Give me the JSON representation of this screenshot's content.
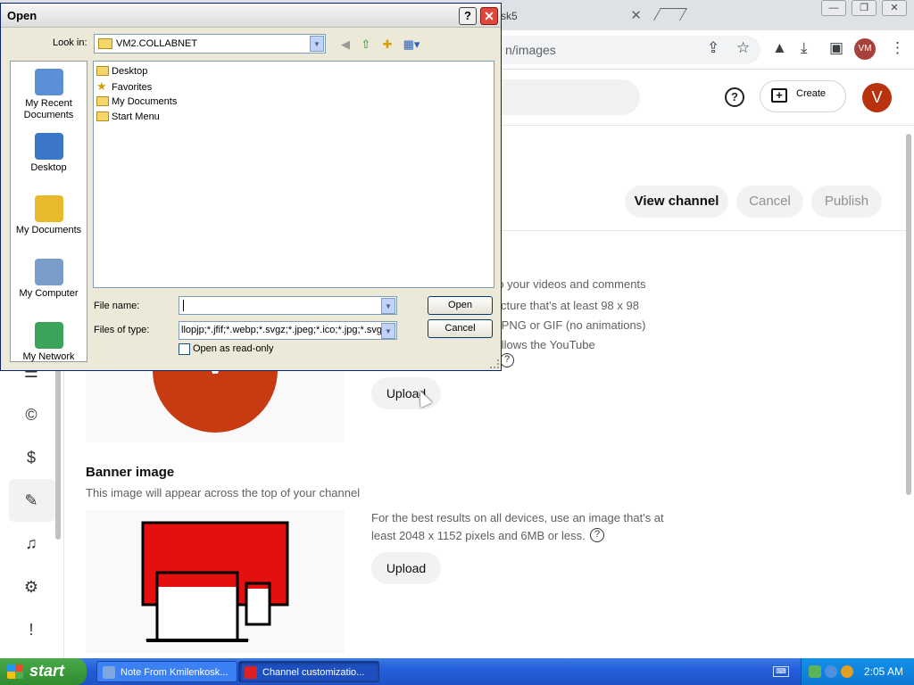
{
  "browser": {
    "tab_title": "sk5",
    "url_fragment": "n/images",
    "profile_initials": "VM",
    "window_buttons": [
      "—",
      "❐",
      "✕"
    ]
  },
  "studio": {
    "create_label": "Create",
    "avatar_letter": "V",
    "actions": {
      "view_channel": "View channel",
      "cancel": "Cancel",
      "publish": "Publish"
    },
    "picture": {
      "desc_lines": [
        "xt to your videos and comments",
        "a picture that's at least 98 x 98",
        "e a PNG or GIF (no animations)",
        "e follows the YouTube"
      ],
      "avatar_letter": "V",
      "upload_label": "Upload"
    },
    "banner": {
      "title": "Banner image",
      "subtitle": "This image will appear across the top of your channel",
      "desc_line1": "For the best results on all devices, use an image that's at",
      "desc_line2": "least 2048 x 1152 pixels and 6MB or less.",
      "upload_label": "Upload"
    },
    "sidebar_icons": [
      "subtitles-icon",
      "copyright-icon",
      "monetization-icon",
      "customization-icon",
      "audio-library-icon",
      "settings-icon",
      "feedback-icon"
    ]
  },
  "dialog": {
    "title": "Open",
    "help_glyph": "?",
    "close_glyph": "✕",
    "look_in_label": "Look in:",
    "look_in_value": "VM2.COLLABNET",
    "places": [
      {
        "label": "My Recent Documents",
        "color": "#5b8fd6"
      },
      {
        "label": "Desktop",
        "color": "#3a77c9"
      },
      {
        "label": "My Documents",
        "color": "#e8b92c"
      },
      {
        "label": "My Computer",
        "color": "#7a9cc9"
      },
      {
        "label": "My Network",
        "color": "#3aa55a"
      }
    ],
    "files": [
      {
        "name": "Desktop",
        "icon": "folder-icon"
      },
      {
        "name": "Favorites",
        "icon": "star-icon"
      },
      {
        "name": "My Documents",
        "icon": "folder-icon"
      },
      {
        "name": "Start Menu",
        "icon": "folder-icon"
      }
    ],
    "file_name_label": "File name:",
    "file_name_value": "",
    "files_of_type_label": "Files of type:",
    "files_of_type_value": "llopjp;*.jfif;*.webp;*.svgz;*.jpeg;*.ico;*.jpg;*.svg;*",
    "open_label": "Open",
    "cancel_label": "Cancel",
    "readonly_label": "Open as read-only"
  },
  "taskbar": {
    "start_label": "start",
    "tasks": [
      {
        "label": "Note From Kmilenkosk...",
        "color": "#7ea6e0"
      },
      {
        "label": "Channel customizatio...",
        "color": "#e02020"
      }
    ],
    "clock": "2:05 AM"
  },
  "colors": {
    "accent_red": "#c73a12",
    "xp_blue": "#245edb",
    "banner_red": "#e41010"
  }
}
